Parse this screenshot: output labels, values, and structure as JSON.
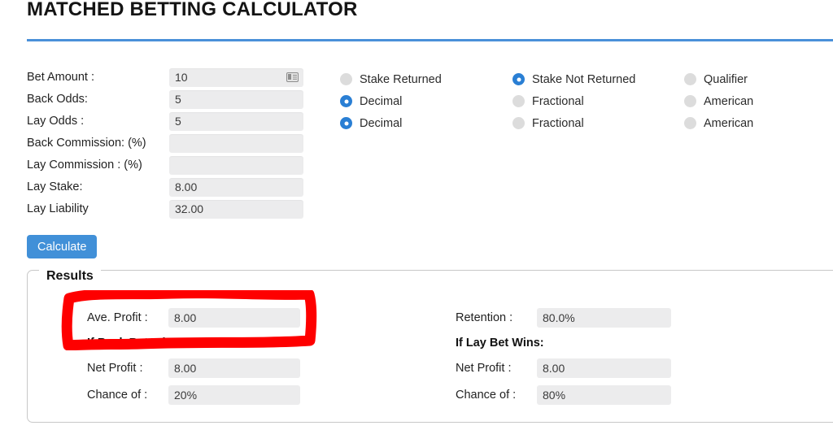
{
  "header": {
    "title": "MATCHED BETTING CALCULATOR",
    "rule_color": "#4a90d9"
  },
  "form": {
    "rows": [
      {
        "label": "Bet Amount :",
        "value": "10",
        "icon": "autofill-contact-card-icon"
      },
      {
        "label": "Back Odds:",
        "value": "5",
        "icon": ""
      },
      {
        "label": "Lay Odds :",
        "value": "5",
        "icon": ""
      },
      {
        "label": "Back Commission: (%)",
        "value": "",
        "icon": ""
      },
      {
        "label": "Lay Commission : (%)",
        "value": "",
        "icon": ""
      },
      {
        "label": "Lay Stake:",
        "value": "8.00",
        "icon": ""
      },
      {
        "label": "Lay Liability",
        "value": "32.00",
        "icon": ""
      }
    ]
  },
  "options": {
    "selected_color": "#2a7fd4",
    "unselected_color": "#dcdcdc",
    "rows": [
      {
        "name": "stake-return-mode",
        "cells": [
          {
            "label": "Stake Returned",
            "selected": false
          },
          {
            "label": "Stake Not Returned",
            "selected": true
          },
          {
            "label": "Qualifier",
            "selected": false
          }
        ]
      },
      {
        "name": "back-odds-format",
        "cells": [
          {
            "label": "Decimal",
            "selected": true
          },
          {
            "label": "Fractional",
            "selected": false
          },
          {
            "label": "American",
            "selected": false
          }
        ]
      },
      {
        "name": "lay-odds-format",
        "cells": [
          {
            "label": "Decimal",
            "selected": true
          },
          {
            "label": "Fractional",
            "selected": false
          },
          {
            "label": "American",
            "selected": false
          }
        ]
      }
    ]
  },
  "actions": {
    "calculate_label": "Calculate",
    "calculate_color": "#4190d8"
  },
  "results": {
    "legend": "Results",
    "left": {
      "summary_label": "Ave. Profit :",
      "summary_value": "8.00",
      "heading": "If Back Bet Wins:",
      "rows": [
        {
          "label": "Net Profit :",
          "value": "8.00"
        },
        {
          "label": "Chance of :",
          "value": "20%"
        }
      ]
    },
    "right": {
      "summary_label": "Retention :",
      "summary_value": "80.0%",
      "heading": "If Lay Bet Wins:",
      "rows": [
        {
          "label": "Net Profit :",
          "value": "8.00"
        },
        {
          "label": "Chance of :",
          "value": "80%"
        }
      ]
    }
  },
  "annotation": {
    "shape": "red-rectangle-highlight",
    "color": "#fe0000"
  }
}
